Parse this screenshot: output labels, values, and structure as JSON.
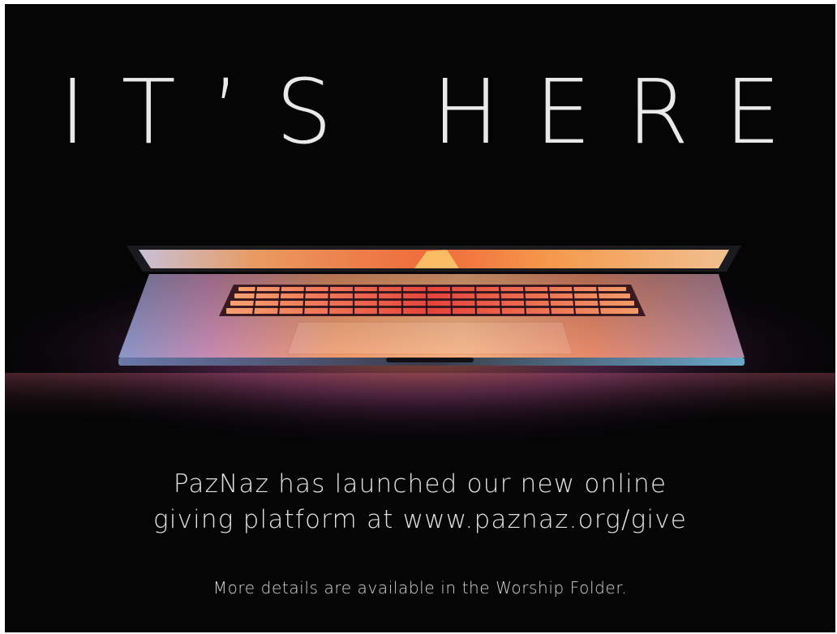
{
  "slide": {
    "headline": "IT’S HERE",
    "body_line_1": "PazNaz has launched our new online",
    "body_line_2": "giving platform at www.paznaz.org/give",
    "footnote": "More details are available in the Worship Folder."
  },
  "image": {
    "subject": "laptop-half-open-glowing-gradient-icon",
    "colors": {
      "background": "#050506",
      "glow_orange": "#f08a3c",
      "glow_pink": "#d94f8a",
      "glow_purple": "#7a4fc9",
      "glow_blue": "#4fb6e6",
      "keyboard_red": "#e23a3a"
    }
  }
}
